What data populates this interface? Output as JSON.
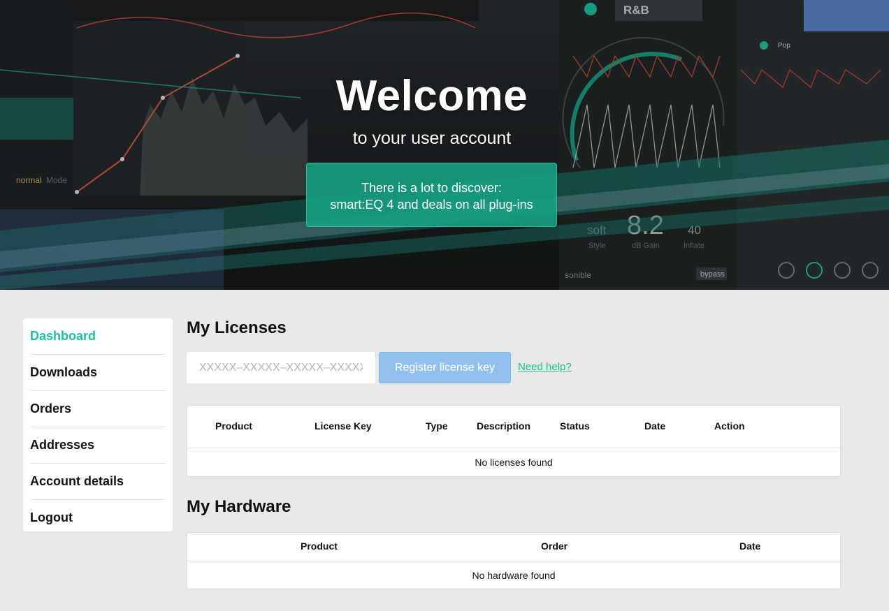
{
  "hero": {
    "title": "Welcome",
    "subtitle": "to your user account",
    "cta_line1": "There is a lot to discover:",
    "cta_line2": "smart:EQ 4 and deals on all plug-ins",
    "cta_color": "#16a082",
    "background_image_labels": {
      "preset": "R&B",
      "genre": "Pop",
      "mode": "normal",
      "mode_label": "Mode",
      "style_value": "soft",
      "style_label": "Style",
      "gain_value": "8.2",
      "gain_label": "dB Gain",
      "inflate_value": "40",
      "inflate_label": "Inflate",
      "brand": "sonible",
      "bypass": "bypass"
    }
  },
  "sidebar": {
    "items": [
      {
        "label": "Dashboard",
        "active": true
      },
      {
        "label": "Downloads",
        "active": false
      },
      {
        "label": "Orders",
        "active": false
      },
      {
        "label": "Addresses",
        "active": false
      },
      {
        "label": "Account details",
        "active": false
      },
      {
        "label": "Logout",
        "active": false
      }
    ],
    "active_color": "#1fbf9a"
  },
  "licenses": {
    "title": "My Licenses",
    "input_placeholder": "XXXXX–XXXXX–XXXXX–XXXXX",
    "register_label": "Register license key",
    "help_label": "Need help?",
    "columns": [
      "Product",
      "License Key",
      "Type",
      "Description",
      "Status",
      "Date",
      "Action"
    ],
    "empty_text": "No licenses found"
  },
  "hardware": {
    "title": "My Hardware",
    "columns": [
      "Product",
      "Order",
      "Date"
    ],
    "empty_text": "No hardware found"
  }
}
